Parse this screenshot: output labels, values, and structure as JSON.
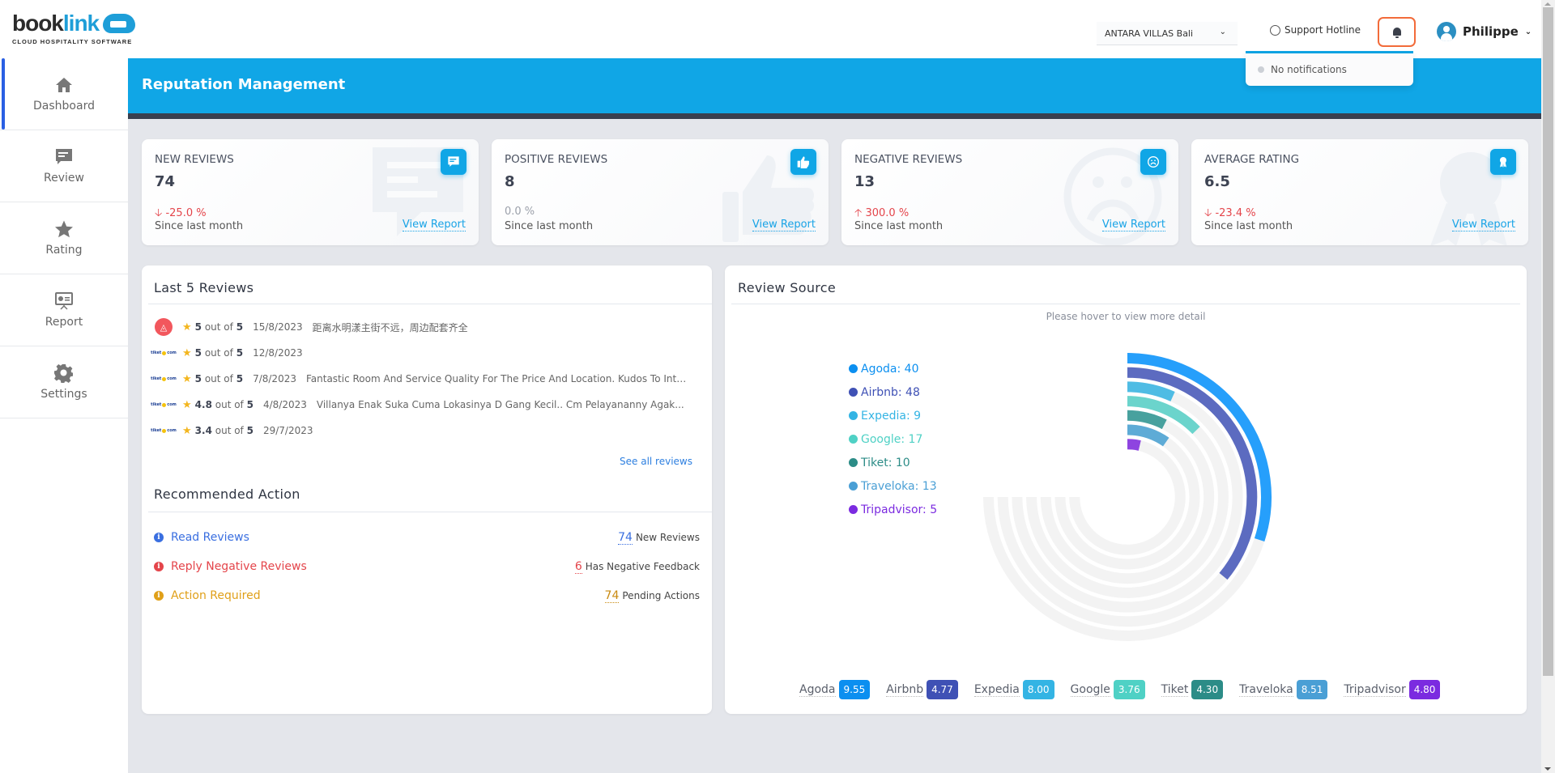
{
  "app": {
    "logo_text_1": "book",
    "logo_text_2": "link",
    "logo_tagline": "CLOUD HOSPITALITY SOFTWARE"
  },
  "header": {
    "property_select": "ANTARA VILLAS Bali",
    "support_label": "Support Hotline",
    "user_name": "Philippe",
    "notifications": {
      "empty_text": "No notifications"
    }
  },
  "sidebar": {
    "items": [
      {
        "label": "Dashboard",
        "icon": "home-icon",
        "active": true
      },
      {
        "label": "Review",
        "icon": "comment-icon",
        "active": false
      },
      {
        "label": "Rating",
        "icon": "star-icon",
        "active": false
      },
      {
        "label": "Report",
        "icon": "presentation-icon",
        "active": false
      },
      {
        "label": "Settings",
        "icon": "gear-icon",
        "active": false
      }
    ]
  },
  "page": {
    "title": "Reputation Management"
  },
  "stats": [
    {
      "title": "NEW REVIEWS",
      "value": "74",
      "change": "-25.0 %",
      "direction": "down",
      "since": "Since last month",
      "link": "View Report",
      "icon": "comment-icon"
    },
    {
      "title": "POSITIVE REVIEWS",
      "value": "8",
      "change": "0.0 %",
      "direction": "flat",
      "since": "Since last month",
      "link": "View Report",
      "icon": "thumbs-up-icon"
    },
    {
      "title": "NEGATIVE REVIEWS",
      "value": "13",
      "change": "300.0 %",
      "direction": "up",
      "since": "Since last month",
      "link": "View Report",
      "icon": "sad-face-icon"
    },
    {
      "title": "AVERAGE RATING",
      "value": "6.5",
      "change": "-23.4 %",
      "direction": "down",
      "since": "Since last month",
      "link": "View Report",
      "icon": "award-icon"
    }
  ],
  "last_reviews": {
    "title": "Last 5 Reviews",
    "out_of_label": "out of",
    "max": "5",
    "items": [
      {
        "source": "airbnb",
        "rating": "5",
        "date": "15/8/2023",
        "text": "距离水明漾主街不远，周边配套齐全"
      },
      {
        "source": "tiket",
        "rating": "5",
        "date": "12/8/2023",
        "text": ""
      },
      {
        "source": "tiket",
        "rating": "5",
        "date": "7/8/2023",
        "text": "Fantastic Room And Service Quality For The Price And Location. Kudos To Intan..."
      },
      {
        "source": "tiket",
        "rating": "4.8",
        "date": "4/8/2023",
        "text": "Villanya Enak Suka Cuma Lokasinya D Gang Kecil.. Cm Pelayananny Agak..."
      },
      {
        "source": "tiket",
        "rating": "3.4",
        "date": "29/7/2023",
        "text": ""
      }
    ],
    "see_all": "See all reviews"
  },
  "recommended": {
    "title": "Recommended Action",
    "items": [
      {
        "label": "Read Reviews",
        "count": "74",
        "suffix": "New Reviews",
        "color": "#3a6fe0"
      },
      {
        "label": "Reply Negative Reviews",
        "count": "6",
        "suffix": "Has Negative Feedback",
        "color": "#e4454b"
      },
      {
        "label": "Action Required",
        "count": "74",
        "suffix": "Pending Actions",
        "color": "#e0a019"
      }
    ]
  },
  "review_source": {
    "title": "Review Source",
    "hint": "Please hover to view more detail",
    "ratings": [
      {
        "name": "Agoda",
        "score": "9.55",
        "color": "#0b8ff0"
      },
      {
        "name": "Airbnb",
        "score": "4.77",
        "color": "#3f51b5"
      },
      {
        "name": "Expedia",
        "score": "8.00",
        "color": "#34b4e4"
      },
      {
        "name": "Google",
        "score": "3.76",
        "color": "#4fd1c5"
      },
      {
        "name": "Tiket",
        "score": "4.30",
        "color": "#2c8c87"
      },
      {
        "name": "Traveloka",
        "score": "8.51",
        "color": "#4a9fd5"
      },
      {
        "name": "Tripadvisor",
        "score": "4.80",
        "color": "#7b2be0"
      }
    ]
  },
  "chart_data": {
    "type": "radialBar",
    "title": "Review Source",
    "max": 100,
    "sweep_degrees": 270,
    "legend_position": "left",
    "series": [
      {
        "name": "Agoda",
        "value": 40,
        "color": "#269ffb"
      },
      {
        "name": "Airbnb",
        "value": 48,
        "color": "#5c6bc0"
      },
      {
        "name": "Expedia",
        "value": 9,
        "color": "#4fbce4"
      },
      {
        "name": "Google",
        "value": 17,
        "color": "#6bd4cc"
      },
      {
        "name": "Tiket",
        "value": 10,
        "color": "#48a19e"
      },
      {
        "name": "Traveloka",
        "value": 13,
        "color": "#5eabd6"
      },
      {
        "name": "Tripadvisor",
        "value": 5,
        "color": "#8e44e0"
      }
    ],
    "legend_colors": [
      "#0b8ff0",
      "#3f51b5",
      "#34b4e4",
      "#4fd1c5",
      "#2c8c87",
      "#4a9fd5",
      "#7b2be0"
    ],
    "track_color": "#f3f3f3"
  }
}
